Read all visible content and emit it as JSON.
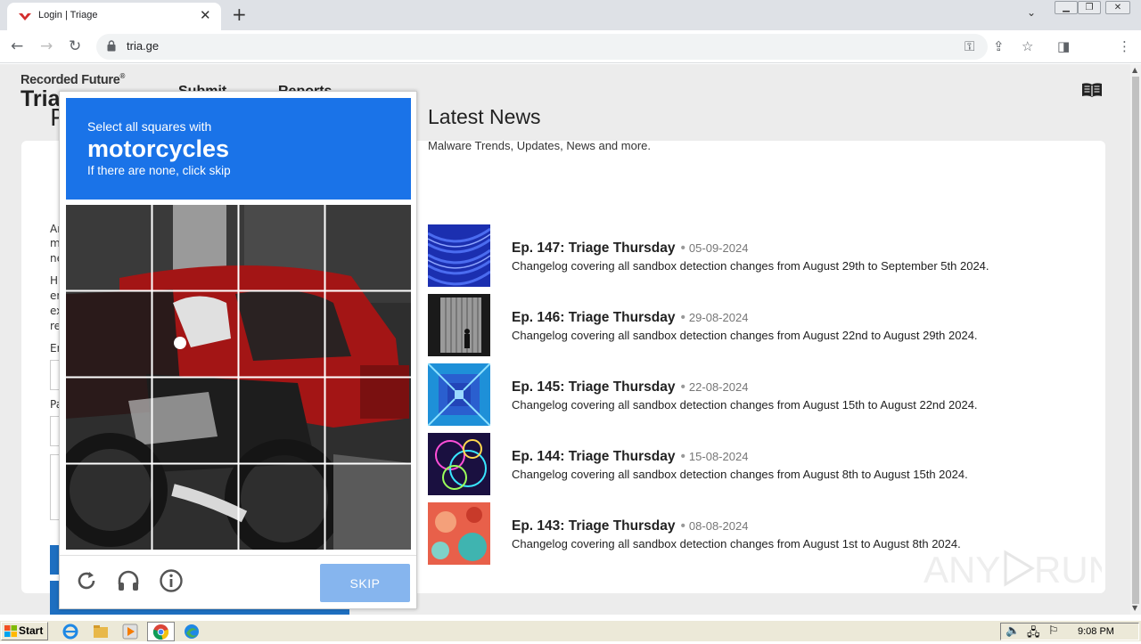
{
  "browser": {
    "tab_title": "Login | Triage",
    "url": "tria.ge"
  },
  "site": {
    "brand_top": "Recorded Future",
    "brand_registered": "®",
    "brand_main": "Triage",
    "brand_main_visible": "Tria",
    "nav": [
      "Submit",
      "Reports"
    ]
  },
  "login": {
    "heading_letter": "P",
    "stubs": [
      "Ar",
      "m",
      "ne",
      "Hi",
      "er",
      "ex",
      "re",
      "Er",
      "Pa"
    ]
  },
  "news": {
    "title": "Latest News",
    "subtitle": "Malware Trends, Updates, News and more.",
    "items": [
      {
        "title": "Ep. 147: Triage Thursday",
        "date": "05-09-2024",
        "desc": "Changelog covering all sandbox detection changes from August 29th to September 5th 2024."
      },
      {
        "title": "Ep. 146: Triage Thursday",
        "date": "29-08-2024",
        "desc": "Changelog covering all sandbox detection changes from August 22nd to August 29th 2024."
      },
      {
        "title": "Ep. 145: Triage Thursday",
        "date": "22-08-2024",
        "desc": "Changelog covering all sandbox detection changes from August 15th to August 22nd 2024."
      },
      {
        "title": "Ep. 144: Triage Thursday",
        "date": "15-08-2024",
        "desc": "Changelog covering all sandbox detection changes from August 8th to August 15th 2024."
      },
      {
        "title": "Ep. 143: Triage Thursday",
        "date": "08-08-2024",
        "desc": "Changelog covering all sandbox detection changes from August 1st to August 8th 2024."
      }
    ],
    "separator": "•"
  },
  "captcha": {
    "prompt": "Select all squares with",
    "target": "motorcycles",
    "hint": "If there are none, click skip",
    "skip_label": "SKIP",
    "grid_size": 4,
    "colors": {
      "header": "#1a73e8",
      "skip": "#86b5ee"
    }
  },
  "taskbar": {
    "start_label": "Start",
    "clock": "9:08 PM"
  },
  "watermark": {
    "text": "ANY RUN"
  }
}
